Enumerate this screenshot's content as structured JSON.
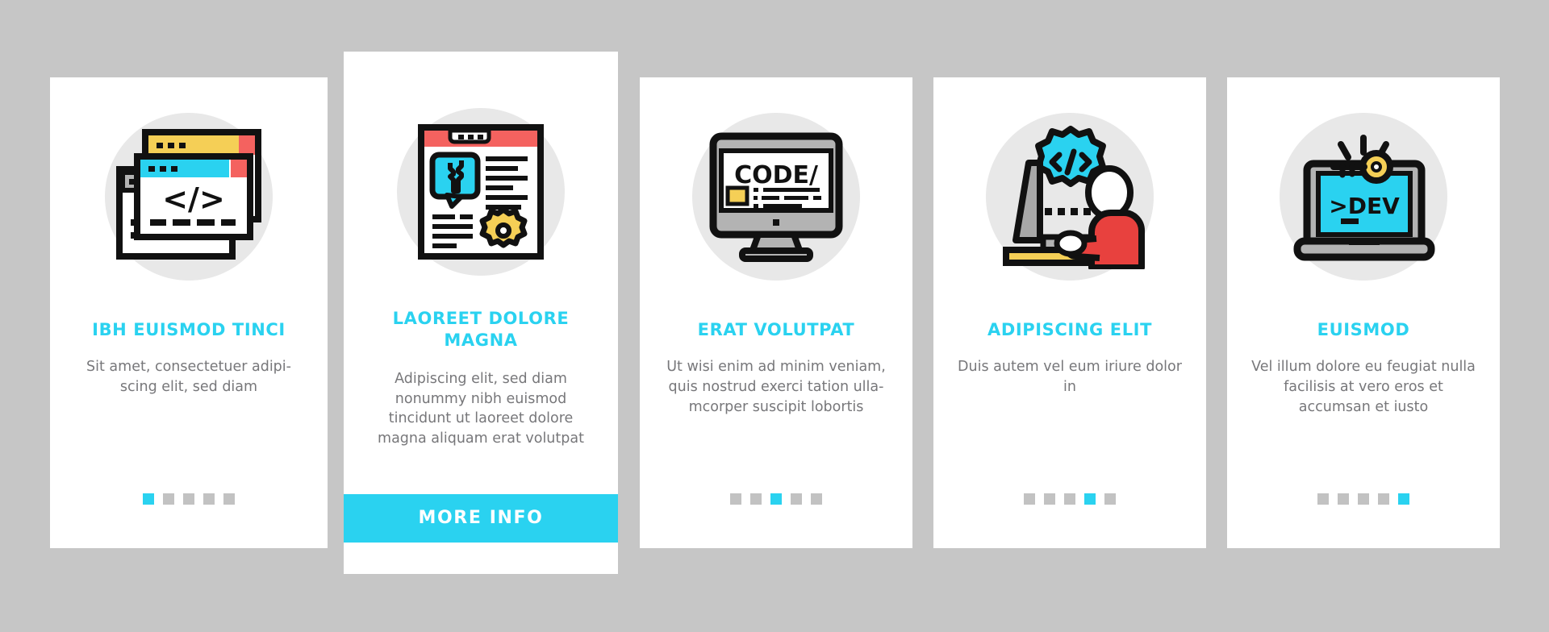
{
  "page": {
    "background_color": "#c6c6c6",
    "accent_color": "#2ad2f0",
    "title_color": "#2ad2f0",
    "body_text_color": "#77777a",
    "card_background": "#ffffff",
    "icon_disc_color": "#e8e8e8"
  },
  "cards": [
    {
      "icon_name": "stacked-browser-windows-code-icon",
      "title": "IBH EUISMOD TINCI",
      "description": "Sit amet, consectetuer adipi-scing elit, sed diam",
      "dots": {
        "count": 5,
        "active_index": 0
      },
      "has_cta": false
    },
    {
      "icon_name": "document-wrench-settings-icon",
      "title": "LAOREET DOLORE MAGNA",
      "description": "Adipiscing elit, sed diam nonummy nibh euismod tincidunt ut laoreet dolore magna aliquam erat volutpat",
      "dots": null,
      "has_cta": true,
      "cta_label": "MORE INFO"
    },
    {
      "icon_name": "desktop-monitor-code-icon",
      "icon_text": "CODE/",
      "title": "ERAT VOLUTPAT",
      "description": "Ut wisi enim ad minim veniam, quis nostrud exerci tation ulla-mcorper suscipit lobortis",
      "dots": {
        "count": 5,
        "active_index": 2
      },
      "has_cta": false
    },
    {
      "icon_name": "developer-at-desk-gear-icon",
      "title": "ADIPISCING ELIT",
      "description": "Duis autem vel eum iriure dolor in",
      "dots": {
        "count": 5,
        "active_index": 3
      },
      "has_cta": false
    },
    {
      "icon_name": "laptop-key-dev-icon",
      "icon_text": ">DEV",
      "title": "EUISMOD",
      "description": "Vel illum dolore eu feugiat nulla facilisis at vero eros et accumsan et iusto",
      "dots": {
        "count": 5,
        "active_index": 4
      },
      "has_cta": false
    }
  ]
}
